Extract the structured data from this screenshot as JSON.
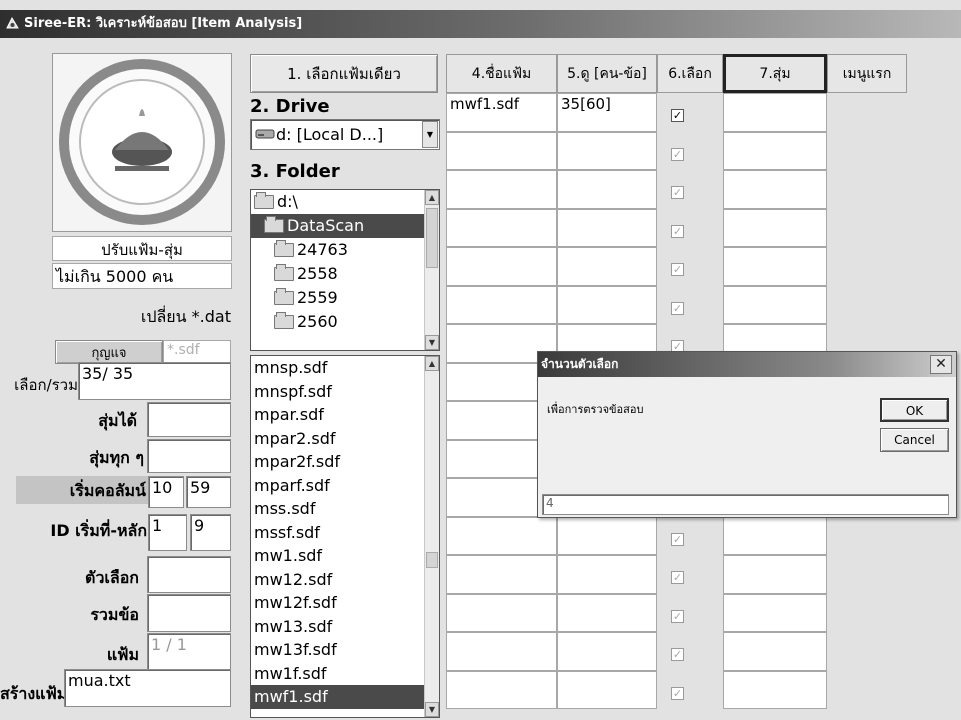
{
  "window": {
    "title": "Siree-ER: วิเคราะห์ข้อสอบ [Item Analysis]"
  },
  "left": {
    "logo_alt": "seal",
    "adjust_label": "ปรับแฟ้ม-สุ่ม",
    "limit_label": "ไม่เกิน 5000 คน",
    "change_label": "เปลี่ยน *.dat",
    "key_button": "กุญแจ",
    "key_ext": "*.sdf",
    "choose_total_label": "เลือก/รวม",
    "choose_total_value": "35/ 35",
    "random_got_label": "สุ่มได้",
    "random_got_value": "",
    "random_every_label": "สุ่มทุก ๆ",
    "random_every_value": "",
    "start_col_label": "เริ่มคอลัมน์",
    "start_col_a": "10",
    "start_col_b": "59",
    "id_start_label": "ID เริ่มที่-หลัก",
    "id_start_a": "1",
    "id_start_b": "9",
    "options_label": "ตัวเลือก",
    "options_value": "",
    "total_items_label": "รวมข้อ",
    "total_items_value": "",
    "file_label": "แฟ้ม",
    "file_value": "1 / 1",
    "create_file_label": "สร้างแฟ้ม",
    "create_file_value": "mua.txt"
  },
  "middle": {
    "select_file_button": "1. เลือกแฟ้มเดียว",
    "drive_label": "2. Drive",
    "drive_value": "d: [Local D...]",
    "folder_label": "3. Folder",
    "folders": [
      {
        "name": "d:\\",
        "selected": false,
        "indent": 0
      },
      {
        "name": "DataScan",
        "selected": true,
        "indent": 1
      },
      {
        "name": "24763",
        "selected": false,
        "indent": 2
      },
      {
        "name": "2558",
        "selected": false,
        "indent": 2
      },
      {
        "name": "2559",
        "selected": false,
        "indent": 2
      },
      {
        "name": "2560",
        "selected": false,
        "indent": 2
      }
    ],
    "files": [
      {
        "name": "mnsp.sdf",
        "selected": false
      },
      {
        "name": "mnspf.sdf",
        "selected": false
      },
      {
        "name": "mpar.sdf",
        "selected": false
      },
      {
        "name": "mpar2.sdf",
        "selected": false
      },
      {
        "name": "mpar2f.sdf",
        "selected": false
      },
      {
        "name": "mparf.sdf",
        "selected": false
      },
      {
        "name": "mss.sdf",
        "selected": false
      },
      {
        "name": "mssf.sdf",
        "selected": false
      },
      {
        "name": "mw1.sdf",
        "selected": false
      },
      {
        "name": "mw12.sdf",
        "selected": false
      },
      {
        "name": "mw12f.sdf",
        "selected": false
      },
      {
        "name": "mw13.sdf",
        "selected": false
      },
      {
        "name": "mw13f.sdf",
        "selected": false
      },
      {
        "name": "mw1f.sdf",
        "selected": false
      },
      {
        "name": "mwf1.sdf",
        "selected": true
      }
    ]
  },
  "grid": {
    "headers": {
      "filename": "4.ชื่อแฟ้ม",
      "view": "5.ดู [คน-ข้อ]",
      "select": "6.เลือก",
      "random": "7.สุ่ม",
      "menu": "เมนูแรก"
    },
    "rows": [
      {
        "filename": "mwf1.sdf",
        "view": "35[60]",
        "checked": true
      },
      {
        "filename": "",
        "view": "",
        "checked": false
      },
      {
        "filename": "",
        "view": "",
        "checked": false
      },
      {
        "filename": "",
        "view": "",
        "checked": false
      },
      {
        "filename": "",
        "view": "",
        "checked": false
      },
      {
        "filename": "",
        "view": "",
        "checked": false
      },
      {
        "filename": "",
        "view": "",
        "checked": false
      },
      {
        "filename": "",
        "view": "",
        "checked": false
      },
      {
        "filename": "",
        "view": "",
        "checked": false
      },
      {
        "filename": "",
        "view": "",
        "checked": false
      },
      {
        "filename": "",
        "view": "",
        "checked": false
      },
      {
        "filename": "",
        "view": "",
        "checked": false
      },
      {
        "filename": "",
        "view": "",
        "checked": false
      },
      {
        "filename": "",
        "view": "",
        "checked": false
      },
      {
        "filename": "",
        "view": "",
        "checked": false
      },
      {
        "filename": "",
        "view": "",
        "checked": false
      }
    ]
  },
  "dialog": {
    "title": "จำนวนตัวเลือก",
    "prompt": "เพื่อการตรวจข้อสอบ",
    "ok": "OK",
    "cancel": "Cancel",
    "input_value": "4",
    "close": "✕"
  }
}
